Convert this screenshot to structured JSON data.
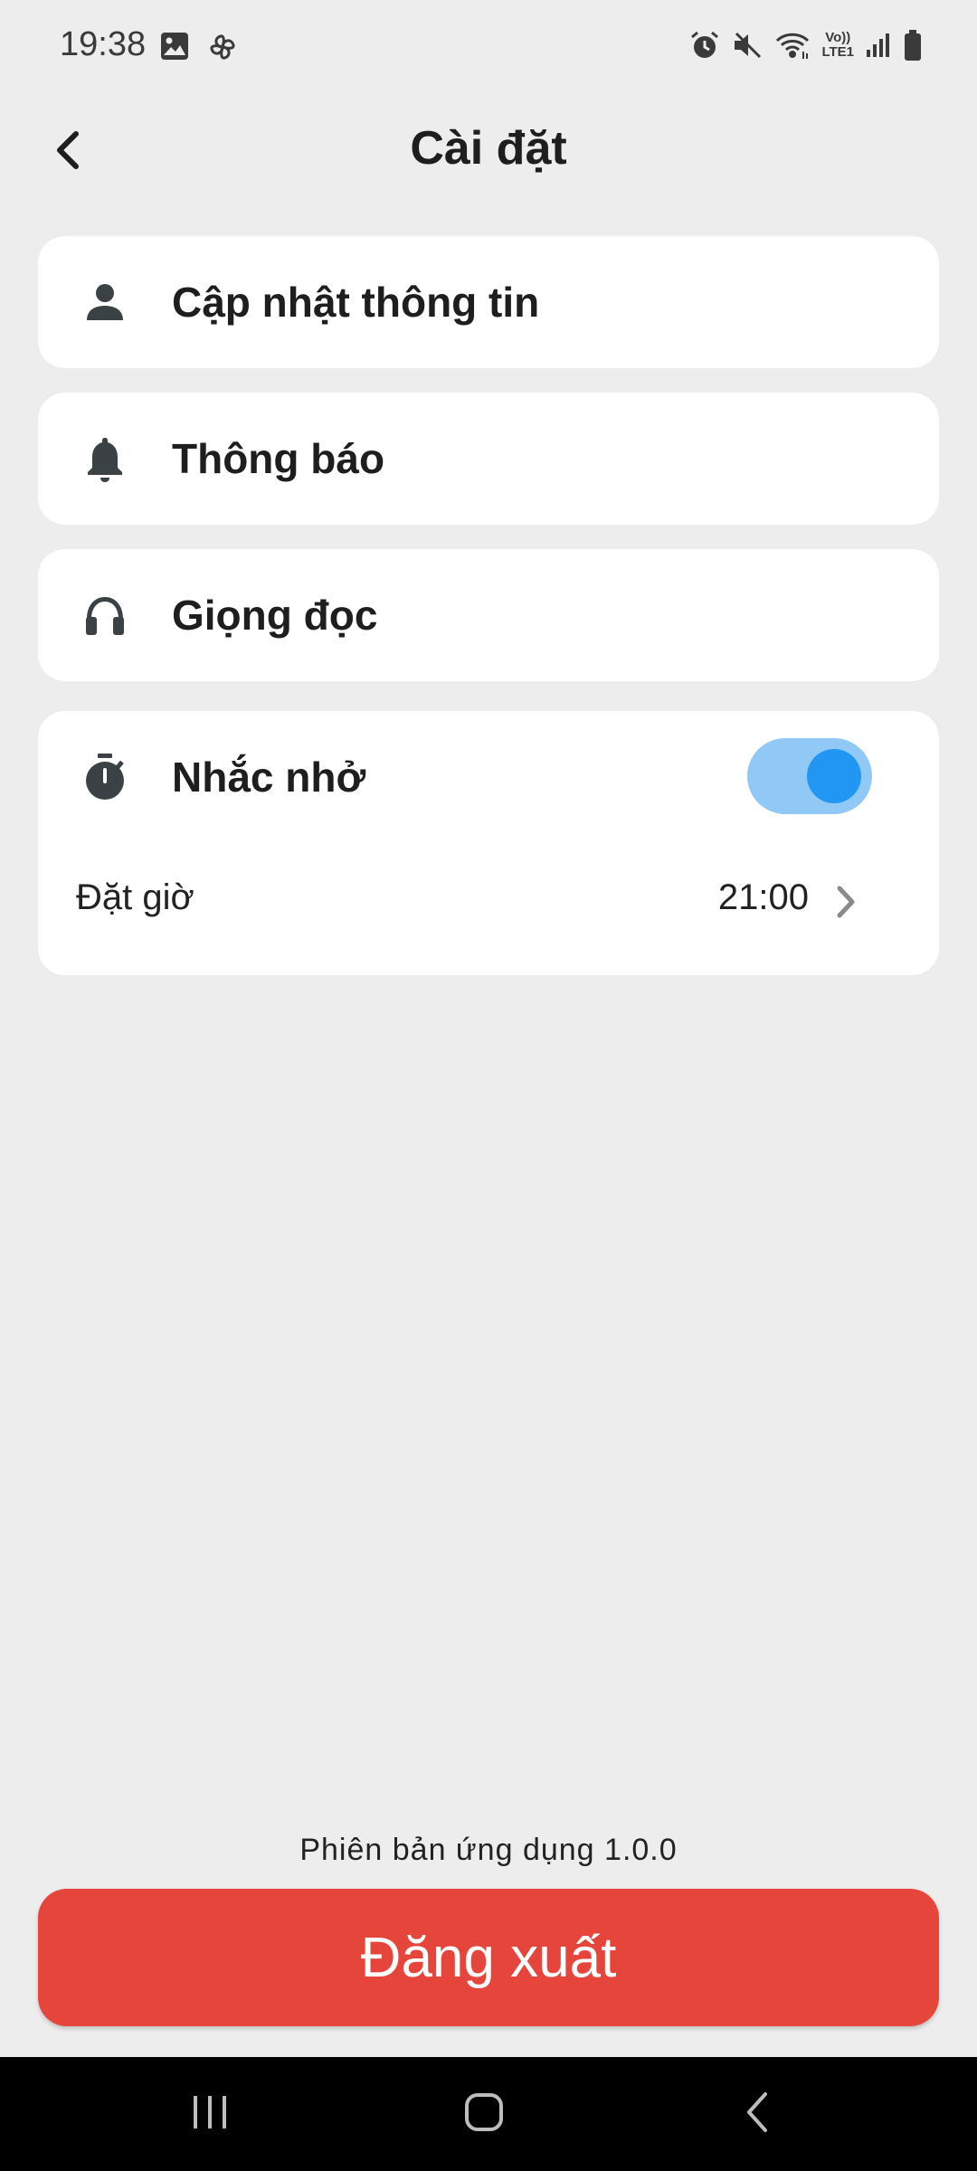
{
  "status_bar": {
    "time": "19:38",
    "left_icons": [
      "image-icon",
      "pinwheel-icon"
    ],
    "right_icons": [
      "alarm-icon",
      "mute-icon",
      "wifi-icon",
      "volte-icon",
      "signal-icon",
      "battery-icon"
    ],
    "volte_top": "Vo))",
    "volte_bottom": "LTE1"
  },
  "app_bar": {
    "back_icon": "chevron-left-icon",
    "title": "Cài đặt"
  },
  "menu": {
    "items": [
      {
        "label": "Cập nhật thông tin",
        "icon": "person-icon"
      },
      {
        "label": "Thông báo",
        "icon": "bell-icon"
      },
      {
        "label": "Giọng đọc",
        "icon": "headphones-icon"
      }
    ]
  },
  "reminder": {
    "label": "Nhắc nhở",
    "icon": "timer-icon",
    "toggle_on": true,
    "time_label": "Đặt giờ",
    "time_value": "21:00"
  },
  "footer": {
    "version": "Phiên bản ứng dụng 1.0.0",
    "logout_label": "Đăng xuất"
  },
  "colors": {
    "background": "#ededed",
    "card": "#ffffff",
    "accent": "#2196f3",
    "toggle_track": "#90c8f6",
    "logout": "#e5453a",
    "icon": "#3a4246"
  },
  "nav_bar": {
    "buttons": [
      "recent-apps-icon",
      "home-icon",
      "back-nav-icon"
    ]
  }
}
